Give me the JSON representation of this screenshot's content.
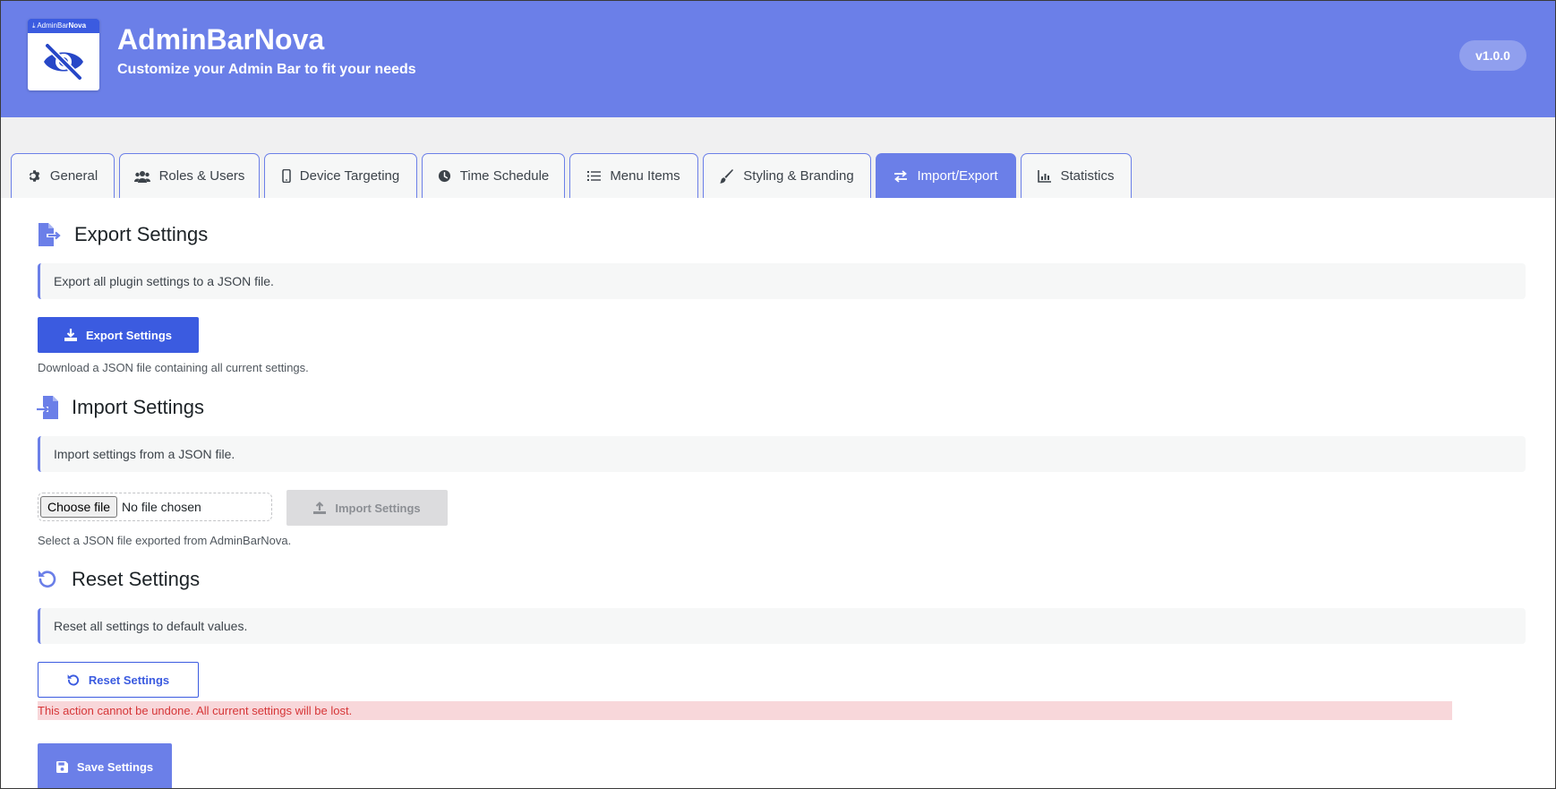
{
  "header": {
    "logo_strip_prefix": "AdminBar",
    "logo_strip_bold": "Nova",
    "title": "AdminBarNova",
    "subtitle": "Customize your Admin Bar to fit your needs",
    "version": "v1.0.0"
  },
  "tabs": [
    {
      "label": "General",
      "icon": "gear-icon",
      "active": false
    },
    {
      "label": "Roles & Users",
      "icon": "users-icon",
      "active": false
    },
    {
      "label": "Device Targeting",
      "icon": "mobile-icon",
      "active": false
    },
    {
      "label": "Time Schedule",
      "icon": "clock-icon",
      "active": false
    },
    {
      "label": "Menu Items",
      "icon": "list-icon",
      "active": false
    },
    {
      "label": "Styling & Branding",
      "icon": "brush-icon",
      "active": false
    },
    {
      "label": "Import/Export",
      "icon": "arrows-exchange-icon",
      "active": true
    },
    {
      "label": "Statistics",
      "icon": "chart-icon",
      "active": false
    }
  ],
  "export": {
    "title": "Export Settings",
    "icon": "file-export-icon",
    "notice": "Export all plugin settings to a JSON file.",
    "button_label": "Export Settings",
    "button_icon": "download-icon",
    "help": "Download a JSON file containing all current settings."
  },
  "import": {
    "title": "Import Settings",
    "icon": "file-import-icon",
    "notice": "Import settings from a JSON file.",
    "file_button_label": "Choose file",
    "file_status": "No file chosen",
    "button_label": "Import Settings",
    "button_icon": "upload-icon",
    "button_disabled": true,
    "help": "Select a JSON file exported from AdminBarNova."
  },
  "reset": {
    "title": "Reset Settings",
    "icon": "undo-icon",
    "notice": "Reset all settings to default values.",
    "button_label": "Reset Settings",
    "warning": "This action cannot be undone. All current settings will be lost."
  },
  "save": {
    "button_label": "Save Settings",
    "button_icon": "floppy-disk-icon"
  },
  "colors": {
    "header_bg": "#6b7fe8",
    "primary": "#3b5be0",
    "warning_text": "#d63638",
    "warning_bg": "#f8d7da"
  }
}
